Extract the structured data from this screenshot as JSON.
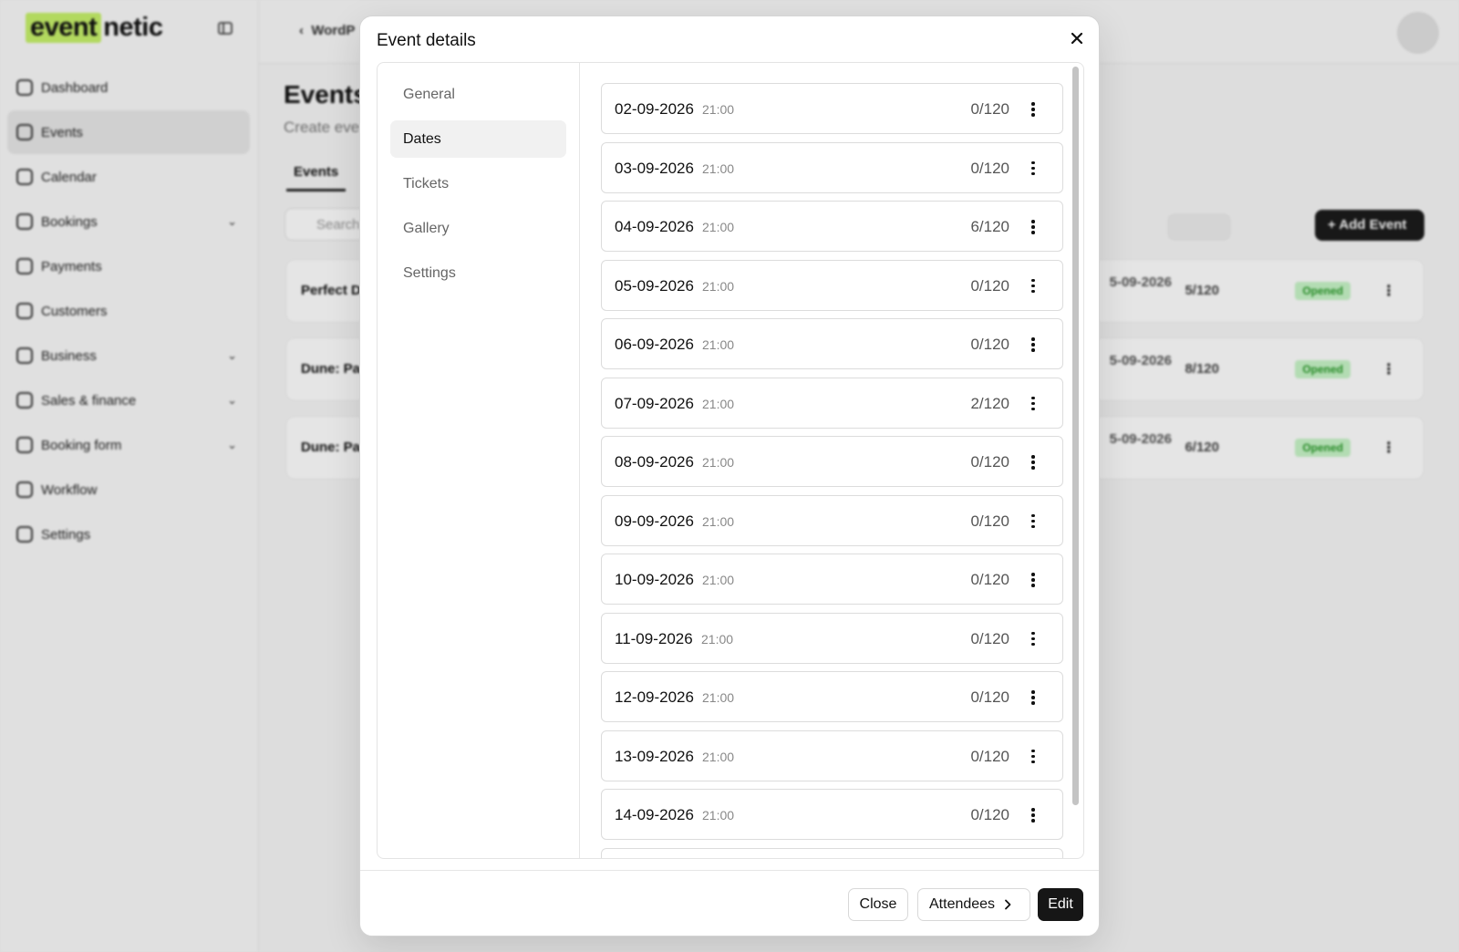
{
  "app": {
    "logo_part1": "event",
    "logo_part2": "netic",
    "nav": [
      {
        "label": "Dashboard"
      },
      {
        "label": "Events"
      },
      {
        "label": "Calendar"
      },
      {
        "label": "Bookings"
      },
      {
        "label": "Payments"
      },
      {
        "label": "Customers"
      },
      {
        "label": "Business"
      },
      {
        "label": "Sales & finance"
      },
      {
        "label": "Booking form"
      },
      {
        "label": "Workflow"
      },
      {
        "label": "Settings"
      }
    ],
    "breadcrumb": "WordP",
    "page_title": "Events",
    "page_subtitle": "Create eve",
    "tab_events": "Events",
    "search_placeholder": "Search",
    "add_event_label": "+ Add Event",
    "rows": [
      {
        "name": "Perfect D",
        "date": "5-09-2026",
        "capacity": "5/120",
        "status": "Opened"
      },
      {
        "name": "Dune: Pa",
        "date": "5-09-2026",
        "capacity": "8/120",
        "status": "Opened"
      },
      {
        "name": "Dune: Pa",
        "date": "5-09-2026",
        "capacity": "6/120",
        "status": "Opened"
      }
    ]
  },
  "modal": {
    "title": "Event details",
    "nav": [
      "General",
      "Dates",
      "Tickets",
      "Gallery",
      "Settings"
    ],
    "active_nav": "Dates",
    "dates": [
      {
        "date": "02-09-2026",
        "time": "21:00",
        "capacity": "0/120"
      },
      {
        "date": "03-09-2026",
        "time": "21:00",
        "capacity": "0/120"
      },
      {
        "date": "04-09-2026",
        "time": "21:00",
        "capacity": "6/120"
      },
      {
        "date": "05-09-2026",
        "time": "21:00",
        "capacity": "0/120"
      },
      {
        "date": "06-09-2026",
        "time": "21:00",
        "capacity": "0/120"
      },
      {
        "date": "07-09-2026",
        "time": "21:00",
        "capacity": "2/120"
      },
      {
        "date": "08-09-2026",
        "time": "21:00",
        "capacity": "0/120"
      },
      {
        "date": "09-09-2026",
        "time": "21:00",
        "capacity": "0/120"
      },
      {
        "date": "10-09-2026",
        "time": "21:00",
        "capacity": "0/120"
      },
      {
        "date": "11-09-2026",
        "time": "21:00",
        "capacity": "0/120"
      },
      {
        "date": "12-09-2026",
        "time": "21:00",
        "capacity": "0/120"
      },
      {
        "date": "13-09-2026",
        "time": "21:00",
        "capacity": "0/120"
      },
      {
        "date": "14-09-2026",
        "time": "21:00",
        "capacity": "0/120"
      },
      {
        "date": "",
        "time": "",
        "capacity": ""
      }
    ],
    "footer": {
      "close_label": "Close",
      "attendees_label": "Attendees",
      "edit_label": "Edit"
    }
  }
}
